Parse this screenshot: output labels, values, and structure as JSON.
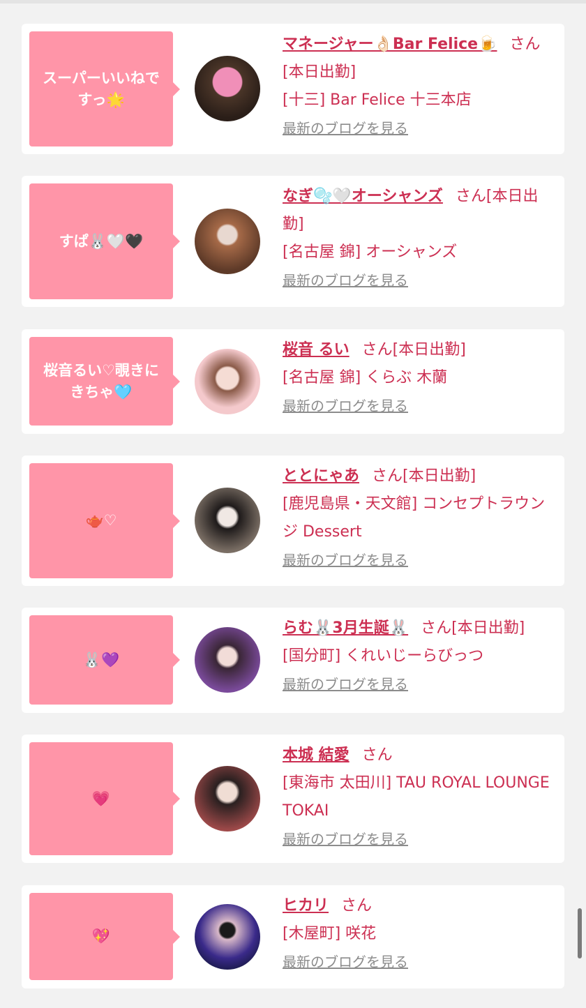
{
  "colors": {
    "name_pink": "#cc2f52",
    "bubble_pink": "#ff95a8",
    "page_bg": "#f2f2f2",
    "link_gray": "#8c8c8c"
  },
  "cards": [
    {
      "bubble": "スーパーいいねですっ🌟",
      "name": "マネージャー👌🏻Bar Felice🍺",
      "suffix": "さん[本日出勤]",
      "shop": "[十三] Bar Felice 十三本店",
      "blog": "最新のブログを見る"
    },
    {
      "bubble": "すぱ🐰🤍🖤",
      "name": "なぎ🫧🤍オーシャンズ",
      "suffix": "さん[本日出勤]",
      "shop": "[名古屋 錦] オーシャンズ",
      "blog": "最新のブログを見る"
    },
    {
      "bubble": "桜音るい♡覗きにきちゃ🩵",
      "name": "桜音 るい",
      "suffix": "さん[本日出勤]",
      "shop": "[名古屋 錦] くらぶ 木蘭",
      "blog": "最新のブログを見る"
    },
    {
      "bubble": "🫖♡",
      "name": "ととにゃあ",
      "suffix": "さん[本日出勤]",
      "shop": "[鹿児島県・天文館] コンセプトラウンジ Dessert",
      "blog": "最新のブログを見る"
    },
    {
      "bubble": "🐰💜",
      "name": "らむ🐰3月生誕🐰",
      "suffix": "さん[本日出勤]",
      "shop": "[国分町] くれいじーらびっつ",
      "blog": "最新のブログを見る"
    },
    {
      "bubble": "💗",
      "name": "本城 結愛",
      "suffix": "さん",
      "shop": "[東海市 太田川] TAU ROYAL LOUNGE TOKAI",
      "blog": "最新のブログを見る"
    },
    {
      "bubble": "💖",
      "name": "ヒカリ",
      "suffix": "さん",
      "shop": "[木屋町] 咲花",
      "blog": "最新のブログを見る"
    }
  ]
}
